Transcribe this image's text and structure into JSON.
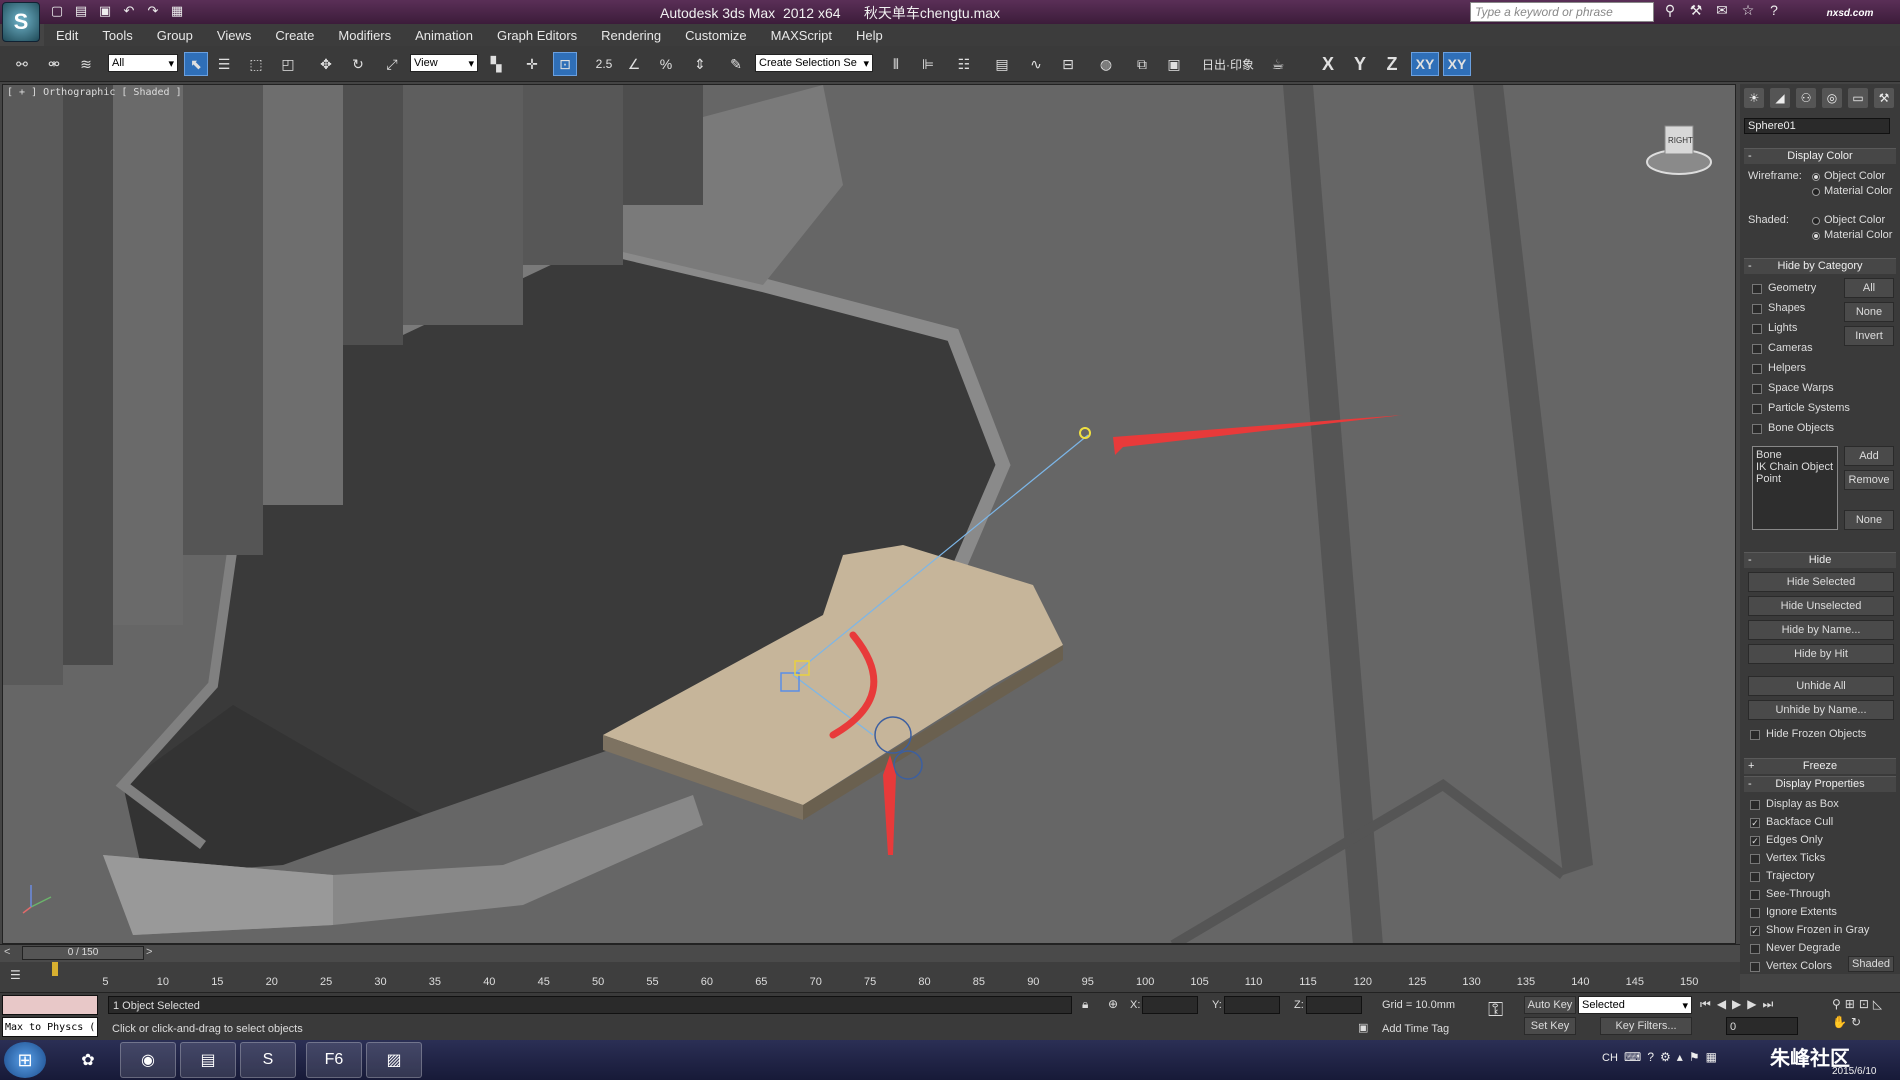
{
  "window": {
    "title": "Autodesk 3ds Max  2012 x64      秋天单车chengtu.max",
    "search_placeholder": "Type a keyword or phrase",
    "brand": "nxsd.com"
  },
  "menu": [
    "Edit",
    "Tools",
    "Group",
    "Views",
    "Create",
    "Modifiers",
    "Animation",
    "Graph Editors",
    "Rendering",
    "Customize",
    "MAXScript",
    "Help"
  ],
  "toolbar": {
    "selection_filter": "All",
    "ref_coord": "View",
    "snap_value": "2.5",
    "named_selection_placeholder": "Create Selection Se",
    "label_sun": "日出·印象",
    "axis_x": "X",
    "axis_y": "Y",
    "axis_z": "Z",
    "axis_xy": "XY",
    "axis_xy2": "XY"
  },
  "viewport": {
    "label": "[ + ] Orthographic [ Shaded ]",
    "viewcube_label": "RIGHT"
  },
  "command_panel": {
    "object_name": "Sphere01",
    "display_color": {
      "title": "Display Color",
      "wireframe_label": "Wireframe:",
      "shaded_label": "Shaded:",
      "object_color": "Object Color",
      "material_color": "Material Color"
    },
    "hide_by_category": {
      "title": "Hide by Category",
      "items": [
        "Geometry",
        "Shapes",
        "Lights",
        "Cameras",
        "Helpers",
        "Space Warps",
        "Particle Systems",
        "Bone Objects"
      ],
      "btn_all": "All",
      "btn_none": "None",
      "btn_invert": "Invert",
      "list": [
        "Bone",
        "IK Chain Object",
        "Point"
      ],
      "btn_add": "Add",
      "btn_remove": "Remove",
      "btn_none2": "None"
    },
    "hide": {
      "title": "Hide",
      "buttons": [
        "Hide Selected",
        "Hide Unselected",
        "Hide by Name...",
        "Hide by Hit",
        "Unhide All",
        "Unhide by Name..."
      ],
      "hide_frozen": "Hide Frozen Objects"
    },
    "freeze": {
      "title": "Freeze"
    },
    "display_properties": {
      "title": "Display Properties",
      "items": [
        {
          "label": "Display as Box",
          "checked": false
        },
        {
          "label": "Backface Cull",
          "checked": true
        },
        {
          "label": "Edges Only",
          "checked": true
        },
        {
          "label": "Vertex Ticks",
          "checked": false
        },
        {
          "label": "Trajectory",
          "checked": false
        },
        {
          "label": "See-Through",
          "checked": false
        },
        {
          "label": "Ignore Extents",
          "checked": false
        },
        {
          "label": "Show Frozen in Gray",
          "checked": true
        },
        {
          "label": "Never Degrade",
          "checked": false
        },
        {
          "label": "Vertex Colors",
          "checked": false
        }
      ],
      "shaded_btn": "Shaded"
    }
  },
  "timeline": {
    "slider": "0 / 150",
    "ticks": [
      "5",
      "10",
      "15",
      "20",
      "25",
      "30",
      "35",
      "40",
      "45",
      "50",
      "55",
      "60",
      "65",
      "70",
      "75",
      "80",
      "85",
      "90",
      "95",
      "100",
      "105",
      "110",
      "115",
      "120",
      "125",
      "130",
      "135",
      "140",
      "145",
      "150"
    ]
  },
  "status": {
    "maxscript_listener": "Max to Physcs (",
    "selected": "1 Object Selected",
    "prompt": "Click or click-and-drag to select objects",
    "x_label": "X:",
    "y_label": "Y:",
    "z_label": "Z:",
    "grid": "Grid = 10.0mm",
    "add_time_tag": "Add Time Tag",
    "auto_key": "Auto Key",
    "set_key": "Set Key",
    "key_mode": "Selected",
    "key_filters": "Key Filters...",
    "frame": "0"
  },
  "taskbar": {
    "ime": "CH",
    "clock": "2015/6/10",
    "watermark": "朱峰社区"
  }
}
